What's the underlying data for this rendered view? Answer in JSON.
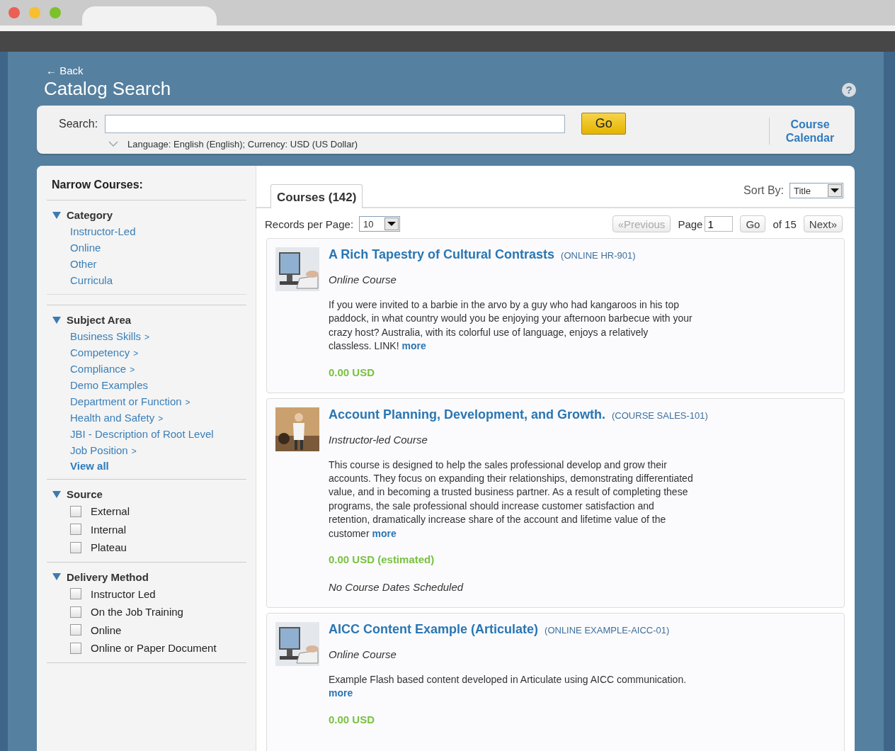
{
  "header": {
    "back_link": "← Back",
    "title": "Catalog Search",
    "help": "?"
  },
  "search": {
    "label": "Search:",
    "go_button": "Go",
    "options": "Language: English (English); Currency: USD (US Dollar)",
    "calendar_link": "Course Calendar"
  },
  "sidebar": {
    "title": "Narrow Courses:",
    "sections": [
      {
        "kind": "links",
        "title": "Category",
        "expanded": true,
        "items": [
          {
            "label": "Instructor-Led"
          },
          {
            "label": "Online"
          },
          {
            "label": "Other"
          },
          {
            "label": "Curricula"
          }
        ]
      },
      {
        "kind": "links",
        "title": "Subject Area",
        "expanded": true,
        "items": [
          {
            "label": "Business Skills",
            "suffix": ">"
          },
          {
            "label": "Competency",
            "suffix": ">"
          },
          {
            "label": "Compliance",
            "suffix": ">"
          },
          {
            "label": "Demo Examples"
          },
          {
            "label": "Department or Function",
            "suffix": ">"
          },
          {
            "label": "Health and Safety",
            "suffix": ">"
          },
          {
            "label": "JBI - Description of Root Level"
          },
          {
            "label": "Job Position",
            "suffix": ">"
          }
        ],
        "view_all": "View all"
      },
      {
        "kind": "checkboxes",
        "title": "Source",
        "expanded": true,
        "items": [
          {
            "label": "External",
            "checked": false
          },
          {
            "label": "Internal",
            "checked": false
          },
          {
            "label": "Plateau",
            "checked": false
          }
        ]
      },
      {
        "kind": "checkboxes",
        "title": "Delivery Method",
        "expanded": true,
        "items": [
          {
            "label": "Instructor Led",
            "checked": false
          },
          {
            "label": "On the Job Training",
            "checked": false
          },
          {
            "label": "Online",
            "checked": false
          },
          {
            "label": "Online or Paper Document",
            "checked": false
          }
        ]
      }
    ]
  },
  "results": {
    "tabs": [
      {
        "label": "Courses (142)",
        "selected": true
      }
    ],
    "sort": {
      "label": "Sort By:",
      "value": "Title"
    },
    "records_per_page": {
      "label": "Records per Page:",
      "value": "10"
    },
    "pagination": {
      "previous": "«Previous",
      "previous_disabled": true,
      "page_label": "Page",
      "page": "1",
      "go": "Go",
      "of": "of 15",
      "next": "Next»"
    },
    "courses": [
      {
        "title": "A Rich Tapestry of Cultural Contrasts",
        "code": "(ONLINE HR-901)",
        "type": "Online Course",
        "kind": "computer",
        "description": "If you were invited to a barbie in the arvo by a guy who had kangaroos in his top paddock, in what country would you be enjoying your afternoon barbecue with your crazy host? Australia, with its colorful use of language, enjoys a relatively classless.   LINK!",
        "more": "more",
        "price": "0.00 USD"
      },
      {
        "title": "Account Planning, Development, and Growth.",
        "code": "(COURSE SALES-101)",
        "type": "Instructor-led Course",
        "kind": "presenter",
        "description": "This course is designed to help the sales professional develop and grow their accounts. They focus on expanding their relationships, demonstrating differentiated value, and in becoming a trusted business partner. As a result of completing these programs, the sale professional should increase customer satisfaction and retention, dramatically increase share of the account and lifetime value of the customer",
        "more": "more",
        "price": "0.00 USD (estimated)",
        "note": "No Course Dates Scheduled"
      },
      {
        "title": "AICC Content Example (Articulate)",
        "code": "(ONLINE EXAMPLE-AICC-01)",
        "type": "Online Course",
        "kind": "computer",
        "description": "Example Flash based content developed in Articulate using AICC communication.",
        "more": "more",
        "price": "0.00 USD"
      }
    ]
  }
}
